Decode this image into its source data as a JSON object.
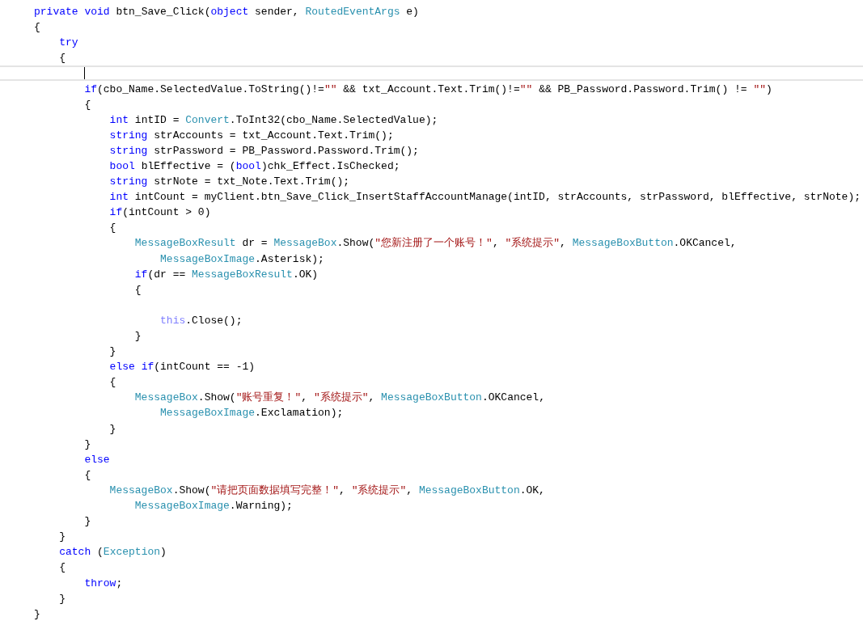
{
  "editor": {
    "lines": [
      {
        "current": false,
        "tokens": [
          {
            "kind": "keyword",
            "text": "private"
          },
          {
            "kind": "keyword",
            "text": " void"
          },
          {
            "kind": "plain",
            "text": " btn_Save_Click("
          },
          {
            "kind": "keyword",
            "text": "object"
          },
          {
            "kind": "plain",
            "text": " sender, "
          },
          {
            "kind": "type",
            "text": "RoutedEventArgs"
          },
          {
            "kind": "plain",
            "text": " e)"
          }
        ]
      },
      {
        "current": false,
        "tokens": [
          {
            "kind": "plain",
            "text": "{"
          }
        ]
      },
      {
        "current": false,
        "tokens": [
          {
            "kind": "keyword",
            "text": "    try"
          }
        ]
      },
      {
        "current": false,
        "tokens": [
          {
            "kind": "plain",
            "text": "    {"
          }
        ]
      },
      {
        "current": true
      },
      {
        "current": false,
        "tokens": [
          {
            "kind": "keyword",
            "text": "        if"
          },
          {
            "kind": "plain",
            "text": "(cbo_Name.SelectedValue.ToString()!="
          },
          {
            "kind": "string",
            "text": "\"\""
          },
          {
            "kind": "plain",
            "text": " && txt_Account.Text.Trim()!="
          },
          {
            "kind": "string",
            "text": "\"\""
          },
          {
            "kind": "plain",
            "text": " && PB_Password.Password.Trim() != "
          },
          {
            "kind": "string",
            "text": "\"\""
          },
          {
            "kind": "plain",
            "text": ")"
          }
        ]
      },
      {
        "current": false,
        "tokens": [
          {
            "kind": "plain",
            "text": "        {"
          }
        ]
      },
      {
        "current": false,
        "tokens": [
          {
            "kind": "keyword",
            "text": "            int"
          },
          {
            "kind": "plain",
            "text": " intID = "
          },
          {
            "kind": "type",
            "text": "Convert"
          },
          {
            "kind": "plain",
            "text": ".ToInt32(cbo_Name.SelectedValue);"
          }
        ]
      },
      {
        "current": false,
        "tokens": [
          {
            "kind": "keyword",
            "text": "            string"
          },
          {
            "kind": "plain",
            "text": " strAccounts = txt_Account.Text.Trim();"
          }
        ]
      },
      {
        "current": false,
        "tokens": [
          {
            "kind": "keyword",
            "text": "            string"
          },
          {
            "kind": "plain",
            "text": " strPassword = PB_Password.Password.Trim();"
          }
        ]
      },
      {
        "current": false,
        "tokens": [
          {
            "kind": "keyword",
            "text": "            bool"
          },
          {
            "kind": "plain",
            "text": " blEffective = ("
          },
          {
            "kind": "keyword",
            "text": "bool"
          },
          {
            "kind": "plain",
            "text": ")chk_Effect.IsChecked;"
          }
        ]
      },
      {
        "current": false,
        "tokens": [
          {
            "kind": "keyword",
            "text": "            string"
          },
          {
            "kind": "plain",
            "text": " strNote = txt_Note.Text.Trim();"
          }
        ]
      },
      {
        "current": false,
        "tokens": [
          {
            "kind": "keyword",
            "text": "            int"
          },
          {
            "kind": "plain",
            "text": " intCount = myClient.btn_Save_Click_InsertStaffAccountManage(intID, strAccounts, strPassword, blEffective, strNote);"
          }
        ]
      },
      {
        "current": false,
        "tokens": [
          {
            "kind": "keyword",
            "text": "            if"
          },
          {
            "kind": "plain",
            "text": "(intCount > 0)"
          }
        ]
      },
      {
        "current": false,
        "tokens": [
          {
            "kind": "plain",
            "text": "            {"
          }
        ]
      },
      {
        "current": false,
        "tokens": [
          {
            "kind": "type",
            "text": "                MessageBoxResult"
          },
          {
            "kind": "plain",
            "text": " dr = "
          },
          {
            "kind": "type",
            "text": "MessageBox"
          },
          {
            "kind": "plain",
            "text": ".Show("
          },
          {
            "kind": "string",
            "text": "\"您新注册了一个账号！\""
          },
          {
            "kind": "plain",
            "text": ", "
          },
          {
            "kind": "string",
            "text": "\"系统提示\""
          },
          {
            "kind": "plain",
            "text": ", "
          },
          {
            "kind": "type",
            "text": "MessageBoxButton"
          },
          {
            "kind": "plain",
            "text": ".OKCancel,"
          }
        ]
      },
      {
        "current": false,
        "tokens": [
          {
            "kind": "type",
            "text": "                    MessageBoxImage"
          },
          {
            "kind": "plain",
            "text": ".Asterisk);"
          }
        ]
      },
      {
        "current": false,
        "tokens": [
          {
            "kind": "keyword",
            "text": "                if"
          },
          {
            "kind": "plain",
            "text": "(dr == "
          },
          {
            "kind": "type",
            "text": "MessageBoxResult"
          },
          {
            "kind": "plain",
            "text": ".OK)"
          }
        ]
      },
      {
        "current": false,
        "tokens": [
          {
            "kind": "plain",
            "text": "                {"
          }
        ]
      },
      {
        "current": false
      },
      {
        "current": false,
        "tokens": [
          {
            "kind": "this",
            "text": "                    this"
          },
          {
            "kind": "plain",
            "text": ".Close();"
          }
        ]
      },
      {
        "current": false,
        "tokens": [
          {
            "kind": "plain",
            "text": "                }"
          }
        ]
      },
      {
        "current": false,
        "tokens": [
          {
            "kind": "plain",
            "text": "            }"
          }
        ]
      },
      {
        "current": false,
        "tokens": [
          {
            "kind": "keyword",
            "text": "            else"
          },
          {
            "kind": "keyword",
            "text": " if"
          },
          {
            "kind": "plain",
            "text": "(intCount == -1)"
          }
        ]
      },
      {
        "current": false,
        "tokens": [
          {
            "kind": "plain",
            "text": "            {"
          }
        ]
      },
      {
        "current": false,
        "tokens": [
          {
            "kind": "type",
            "text": "                MessageBox"
          },
          {
            "kind": "plain",
            "text": ".Show("
          },
          {
            "kind": "string",
            "text": "\"账号重复！\""
          },
          {
            "kind": "plain",
            "text": ", "
          },
          {
            "kind": "string",
            "text": "\"系统提示\""
          },
          {
            "kind": "plain",
            "text": ", "
          },
          {
            "kind": "type",
            "text": "MessageBoxButton"
          },
          {
            "kind": "plain",
            "text": ".OKCancel,"
          }
        ]
      },
      {
        "current": false,
        "tokens": [
          {
            "kind": "type",
            "text": "                    MessageBoxImage"
          },
          {
            "kind": "plain",
            "text": ".Exclamation);"
          }
        ]
      },
      {
        "current": false,
        "tokens": [
          {
            "kind": "plain",
            "text": "            }"
          }
        ]
      },
      {
        "current": false,
        "tokens": [
          {
            "kind": "plain",
            "text": "        }"
          }
        ]
      },
      {
        "current": false,
        "tokens": [
          {
            "kind": "keyword",
            "text": "        else"
          }
        ]
      },
      {
        "current": false,
        "tokens": [
          {
            "kind": "plain",
            "text": "        {"
          }
        ]
      },
      {
        "current": false,
        "tokens": [
          {
            "kind": "type",
            "text": "            MessageBox"
          },
          {
            "kind": "plain",
            "text": ".Show("
          },
          {
            "kind": "string",
            "text": "\"请把页面数据填写完整！\""
          },
          {
            "kind": "plain",
            "text": ", "
          },
          {
            "kind": "string",
            "text": "\"系统提示\""
          },
          {
            "kind": "plain",
            "text": ", "
          },
          {
            "kind": "type",
            "text": "MessageBoxButton"
          },
          {
            "kind": "plain",
            "text": ".OK,"
          }
        ]
      },
      {
        "current": false,
        "tokens": [
          {
            "kind": "type",
            "text": "                MessageBoxImage"
          },
          {
            "kind": "plain",
            "text": ".Warning);"
          }
        ]
      },
      {
        "current": false,
        "tokens": [
          {
            "kind": "plain",
            "text": "        }"
          }
        ]
      },
      {
        "current": false,
        "tokens": [
          {
            "kind": "plain",
            "text": "    }"
          }
        ]
      },
      {
        "current": false,
        "tokens": [
          {
            "kind": "keyword",
            "text": "    catch"
          },
          {
            "kind": "plain",
            "text": " ("
          },
          {
            "kind": "type",
            "text": "Exception"
          },
          {
            "kind": "plain",
            "text": ")"
          }
        ]
      },
      {
        "current": false,
        "tokens": [
          {
            "kind": "plain",
            "text": "    {"
          }
        ]
      },
      {
        "current": false,
        "tokens": [
          {
            "kind": "keyword",
            "text": "        throw"
          },
          {
            "kind": "plain",
            "text": ";"
          }
        ]
      },
      {
        "current": false,
        "tokens": [
          {
            "kind": "plain",
            "text": "    }"
          }
        ]
      },
      {
        "current": false,
        "tokens": [
          {
            "kind": "plain",
            "text": "}"
          }
        ]
      }
    ]
  }
}
